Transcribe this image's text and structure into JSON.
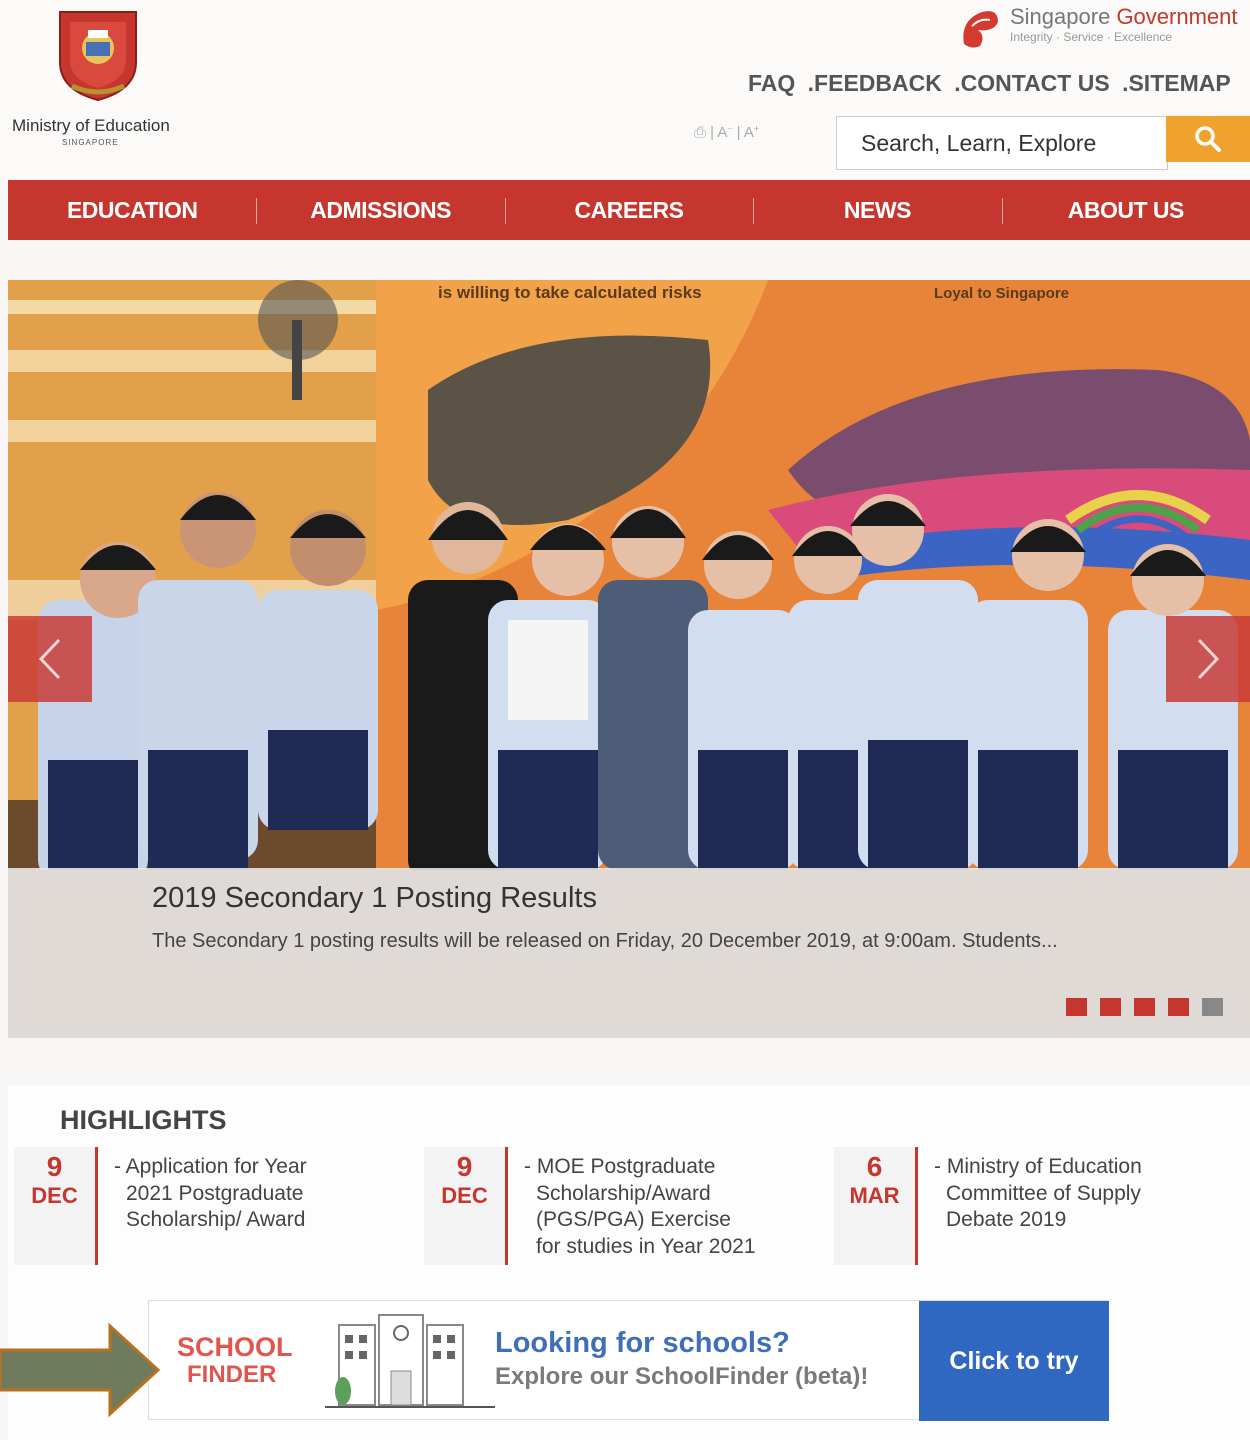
{
  "header": {
    "ministry_name": "Ministry of Education",
    "ministry_sub": "SINGAPORE",
    "gov_title_1": "Singapore",
    "gov_title_2": "Government",
    "gov_tagline": "Integrity · Service · Excellence",
    "top_links": [
      "FAQ",
      ".FEEDBACK",
      ".CONTACT US",
      ".SITEMAP"
    ],
    "tools": "⎙ | A⁻ | A⁺",
    "search_placeholder": "Search, Learn, Explore"
  },
  "nav": {
    "items": [
      "EDUCATION",
      "ADMISSIONS",
      "CAREERS",
      "NEWS",
      "ABOUT US"
    ]
  },
  "hero": {
    "title": "2019 Secondary 1 Posting Results",
    "text": "The Secondary 1 posting results will be released on Friday, 20 December 2019, at 9:00am. Students...",
    "banner_text_1": "is willing to take calculated risks",
    "banner_text_2": "Loyal to Singapore",
    "dots": [
      true,
      true,
      true,
      true,
      false
    ]
  },
  "highlights": {
    "heading": "HIGHLIGHTS",
    "items": [
      {
        "day": "9",
        "month": "DEC",
        "lines": [
          "- Application for Year",
          "  2021 Postgraduate",
          "  Scholarship/ Award"
        ]
      },
      {
        "day": "9",
        "month": "DEC",
        "lines": [
          "- MOE Postgraduate",
          "  Scholarship/Award",
          "  (PGS/PGA) Exercise",
          "  for studies in Year 2021"
        ]
      },
      {
        "day": "6",
        "month": "MAR",
        "lines": [
          "- Ministry of Education",
          "  Committee of Supply",
          "  Debate 2019"
        ]
      }
    ]
  },
  "schoolfinder": {
    "logo_line1": "SCHOOL",
    "logo_line2": "FINDER",
    "heading": "Looking for schools?",
    "sub": "Explore our SchoolFinder (beta)!",
    "cta": "Click to try"
  },
  "colors": {
    "brand_red": "#c4362e",
    "search_orange": "#f0a22e",
    "cta_blue": "#2f67c1",
    "arrow_olive": "#6f7b5c"
  }
}
